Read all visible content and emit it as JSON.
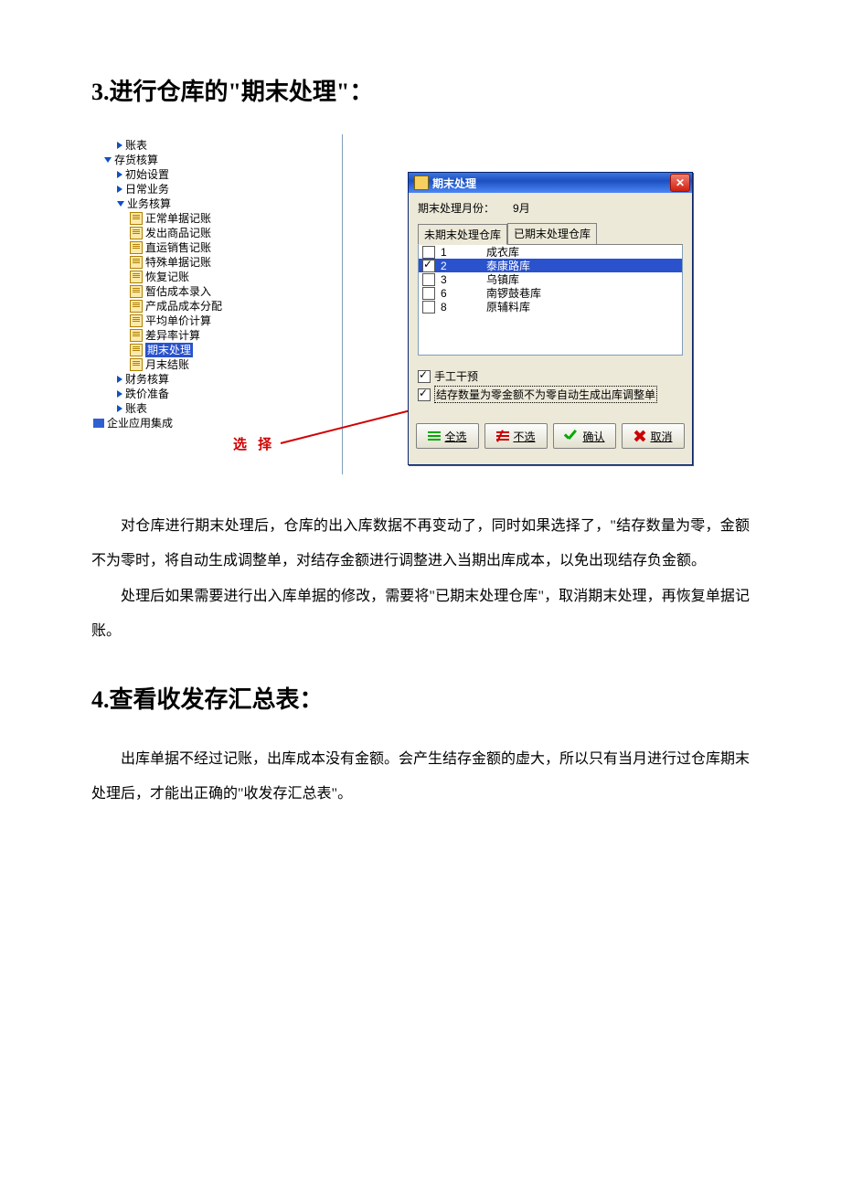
{
  "headings": {
    "h3": "3.进行仓库的\"期末处理\"：",
    "h4": "4.查看收发存汇总表："
  },
  "annotation": {
    "label": "选 择"
  },
  "tree": {
    "top_item": "账表",
    "root": "存货核算",
    "children": [
      {
        "label": "初始设置",
        "type": "folder"
      },
      {
        "label": "日常业务",
        "type": "folder"
      },
      {
        "label": "业务核算",
        "type": "folder_open",
        "children": [
          "正常单据记账",
          "发出商品记账",
          "直运销售记账",
          "特殊单据记账",
          "恢复记账",
          "暂估成本录入",
          "产成品成本分配",
          "平均单价计算",
          "差异率计算",
          "期末处理",
          "月末结账"
        ],
        "selected_index": 9
      },
      {
        "label": "财务核算",
        "type": "folder"
      },
      {
        "label": "跌价准备",
        "type": "folder"
      },
      {
        "label": "账表",
        "type": "folder"
      }
    ],
    "bottom_root": "企业应用集成"
  },
  "dialog": {
    "title": "期末处理",
    "month_label": "期末处理月份：",
    "month_value": "9月",
    "tab_unprocessed": "未期末处理仓库",
    "tab_processed": "已期末处理仓库",
    "rows": [
      {
        "checked": false,
        "code": "1",
        "name": "成衣库"
      },
      {
        "checked": true,
        "code": "2",
        "name": "泰康路库",
        "selected": true
      },
      {
        "checked": false,
        "code": "3",
        "name": "乌镇库"
      },
      {
        "checked": false,
        "code": "6",
        "name": "南锣鼓巷库"
      },
      {
        "checked": false,
        "code": "8",
        "name": "原辅料库"
      }
    ],
    "opt_manual": "手工干预",
    "opt_auto": "结存数量为零金额不为零自动生成出库调整单",
    "btn_all": "全选",
    "btn_none": "不选",
    "btn_ok": "确认",
    "btn_cancel": "取消"
  },
  "paragraphs": {
    "p1": "对仓库进行期末处理后，仓库的出入库数据不再变动了，同时如果选择了，\"结存数量为零，金额不为零时，将自动生成调整单，对结存金额进行调整进入当期出库成本，以免出现结存负金额。",
    "p2": "处理后如果需要进行出入库单据的修改，需要将\"已期末处理仓库\"，取消期末处理，再恢复单据记账。",
    "p3": "出库单据不经过记账，出库成本没有金额。会产生结存金额的虚大，所以只有当月进行过仓库期末处理后，才能出正确的\"收发存汇总表\"。"
  }
}
